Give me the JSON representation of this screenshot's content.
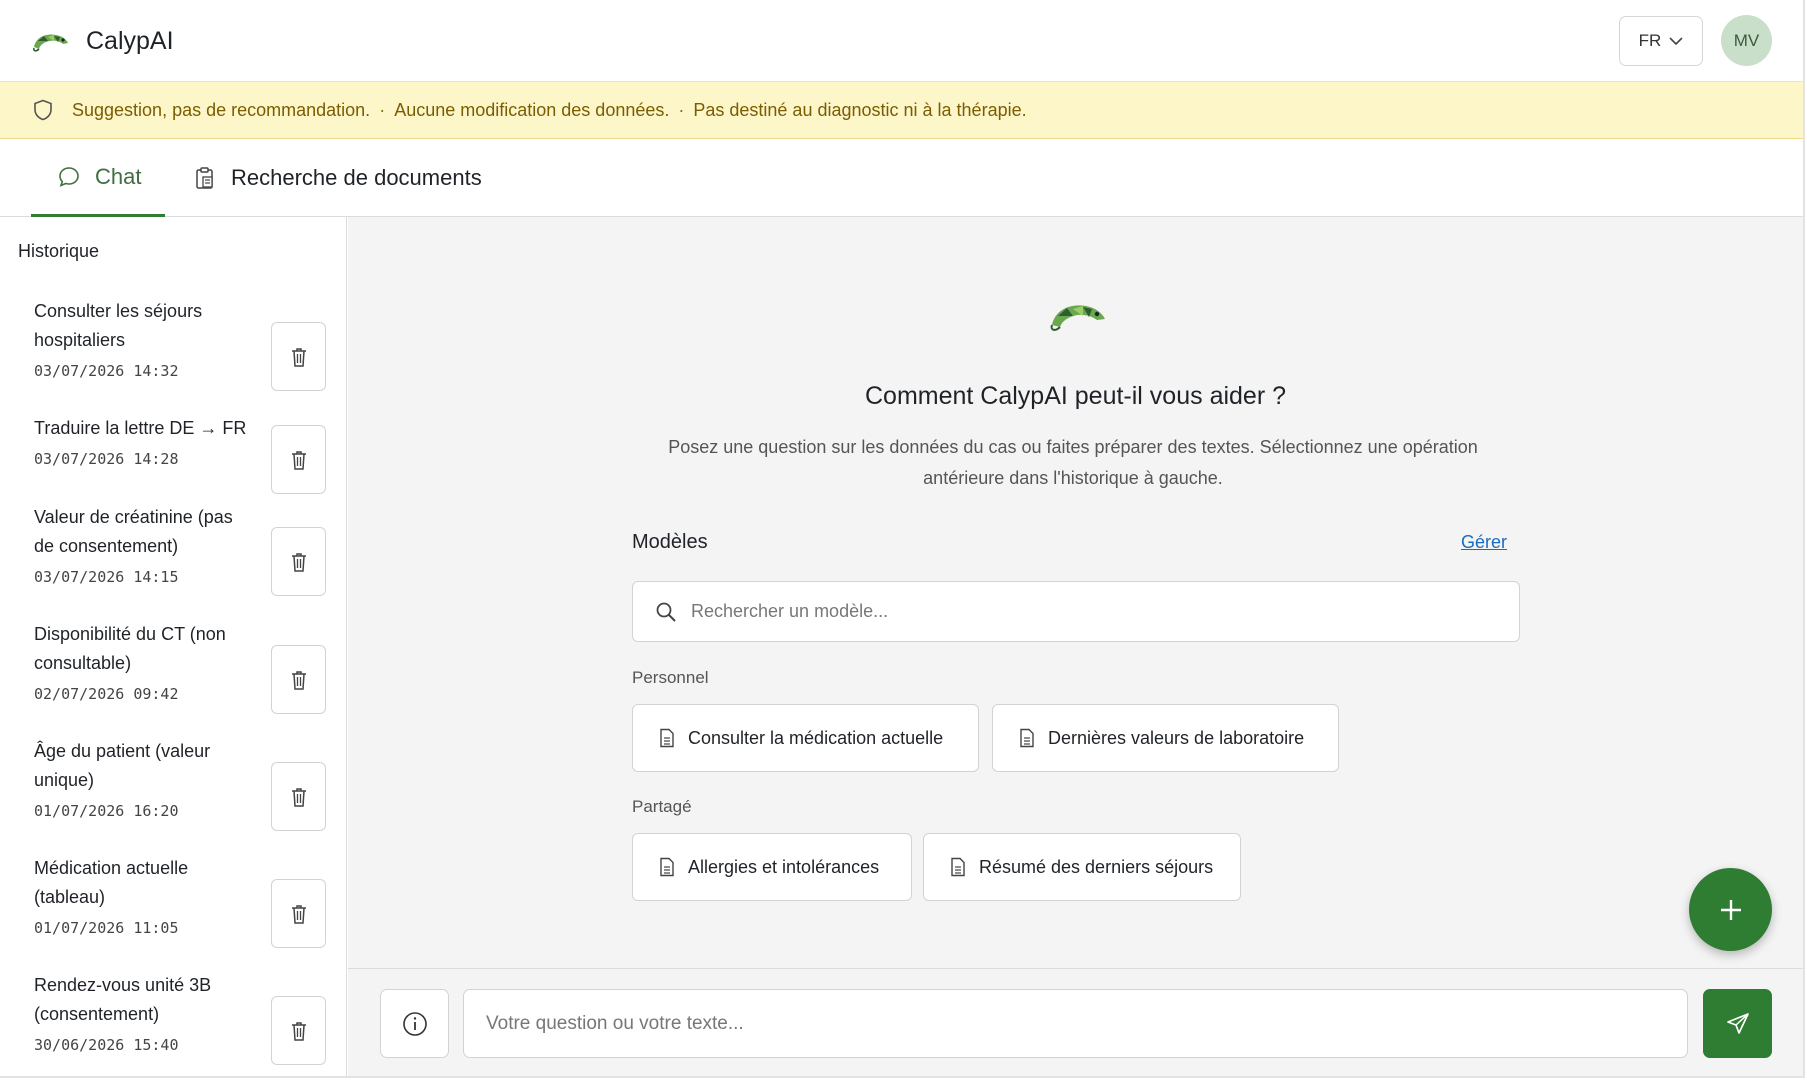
{
  "app": {
    "name": "CalypAI"
  },
  "header": {
    "language": "FR",
    "user_initials": "MV"
  },
  "banner": {
    "items": [
      "Suggestion, pas de recommandation.",
      "Aucune modification des données.",
      "Pas destiné au diagnostic ni à la thérapie."
    ],
    "separator": "·"
  },
  "tabs": [
    {
      "label": "Chat",
      "active": true
    },
    {
      "label": "Recherche de documents",
      "active": false
    }
  ],
  "sidebar": {
    "title": "Historique",
    "items": [
      {
        "title": "Consulter les séjours hospitaliers",
        "date": "03/07/2026 14:32"
      },
      {
        "title": "Traduire la lettre DE → FR",
        "date": "03/07/2026 14:28"
      },
      {
        "title": "Valeur de créatinine (pas de consentement)",
        "date": "03/07/2026 14:15"
      },
      {
        "title": "Disponibilité du CT (non consultable)",
        "date": "02/07/2026 09:42"
      },
      {
        "title": "Âge du patient (valeur unique)",
        "date": "01/07/2026 16:20"
      },
      {
        "title": "Médication actuelle (tableau)",
        "date": "01/07/2026 11:05"
      },
      {
        "title": "Rendez-vous unité 3B (consentement)",
        "date": "30/06/2026 15:40"
      }
    ]
  },
  "main": {
    "title": "Comment CalypAI peut-il vous aider ?",
    "subtitle": "Posez une question sur les données du cas ou faites préparer des textes. Sélectionnez une opération antérieure dans l'historique à gauche.",
    "models_label": "Modèles",
    "manage_label": "Gérer",
    "search_placeholder": "Rechercher un modèle...",
    "groups": [
      {
        "label": "Personnel",
        "templates": [
          "Consulter la médication actuelle",
          "Dernières valeurs de laboratoire"
        ]
      },
      {
        "label": "Partagé",
        "templates": [
          "Allergies et intolérances",
          "Résumé des derniers séjours"
        ]
      }
    ]
  },
  "composer": {
    "placeholder": "Votre question ou votre texte..."
  },
  "colors": {
    "accent": "#2e7d32",
    "banner_bg": "#fdf6c9",
    "banner_text": "#7a5d00",
    "link": "#1a6bbf"
  }
}
